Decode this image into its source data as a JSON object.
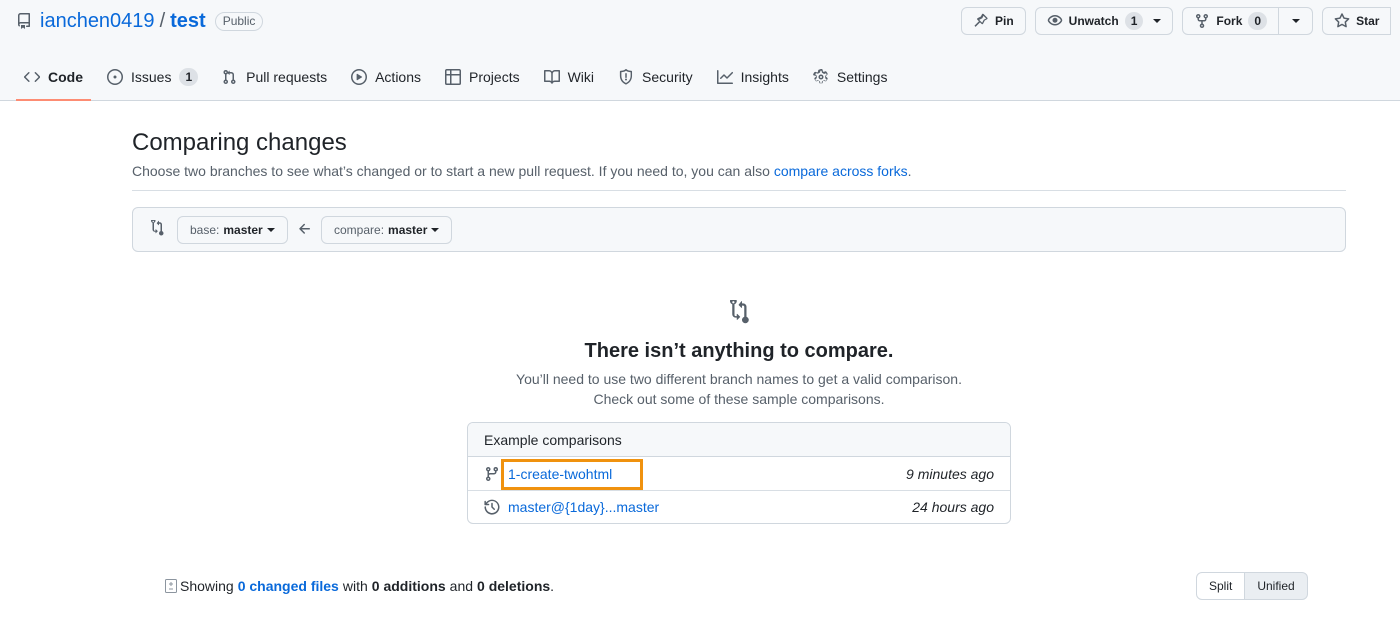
{
  "repo": {
    "owner": "ianchen0419",
    "separator": "/",
    "name": "test",
    "visibility": "Public"
  },
  "actions": {
    "pin_label": "Pin",
    "unwatch_label": "Unwatch",
    "unwatch_count": "1",
    "fork_label": "Fork",
    "fork_count": "0",
    "star_label": "Star"
  },
  "tabs": [
    {
      "label": "Code",
      "icon": "code-icon",
      "selected": true
    },
    {
      "label": "Issues",
      "icon": "issue-opened-icon",
      "count": "1"
    },
    {
      "label": "Pull requests",
      "icon": "git-pull-request-icon"
    },
    {
      "label": "Actions",
      "icon": "play-icon"
    },
    {
      "label": "Projects",
      "icon": "table-icon"
    },
    {
      "label": "Wiki",
      "icon": "book-icon"
    },
    {
      "label": "Security",
      "icon": "shield-icon"
    },
    {
      "label": "Insights",
      "icon": "graph-icon"
    },
    {
      "label": "Settings",
      "icon": "gear-icon"
    }
  ],
  "compare": {
    "title": "Comparing changes",
    "description": "Choose two branches to see what’s changed or to start a new pull request. If you need to, you can also ",
    "description_link": "compare across forks",
    "description_end": ".",
    "base_prefix": "base:",
    "base_branch": "master",
    "compare_prefix": "compare:",
    "compare_branch": "master"
  },
  "blankslate": {
    "title": "There isn’t anything to compare.",
    "line1": "You’ll need to use two different branch names to get a valid comparison.",
    "line2": "Check out some of these sample comparisons."
  },
  "examples": {
    "header": "Example comparisons",
    "rows": [
      {
        "icon": "git-branch-icon",
        "link": "1-create-twohtml",
        "time": "9 minutes ago",
        "highlighted": true
      },
      {
        "icon": "history-icon",
        "link": "master@{1day}...master",
        "time": "24 hours ago"
      }
    ]
  },
  "diff_summary": {
    "showing": "Showing",
    "changed_files": "0 changed files",
    "with": "with",
    "additions": "0 additions",
    "and": "and",
    "deletions": "0 deletions",
    "end": "."
  },
  "view_toggle": {
    "split": "Split",
    "unified": "Unified"
  },
  "colors": {
    "link": "#0969da",
    "tab_underline": "#fd8c73",
    "highlight_box": "#f0920e"
  }
}
